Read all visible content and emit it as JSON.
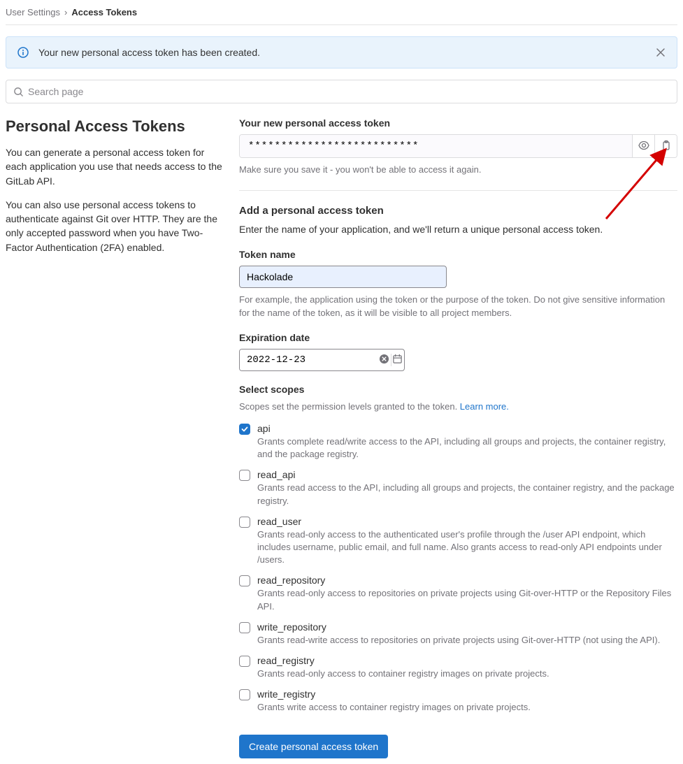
{
  "breadcrumb": {
    "parent": "User Settings",
    "current": "Access Tokens"
  },
  "alert": {
    "message": "Your new personal access token has been created."
  },
  "search": {
    "placeholder": "Search page"
  },
  "sidebar": {
    "heading": "Personal Access Tokens",
    "para1": "You can generate a personal access token for each application you use that needs access to the GitLab API.",
    "para2": "You can also use personal access tokens to authenticate against Git over HTTP. They are the only accepted password when you have Two-Factor Authentication (2FA) enabled."
  },
  "token": {
    "label": "Your new personal access token",
    "value": "**************************",
    "save_hint": "Make sure you save it - you won't be able to access it again."
  },
  "add": {
    "heading": "Add a personal access token",
    "desc": "Enter the name of your application, and we'll return a unique personal access token.",
    "name_label": "Token name",
    "name_value": "Hackolade",
    "name_hint": "For example, the application using the token or the purpose of the token. Do not give sensitive information for the name of the token, as it will be visible to all project members.",
    "exp_label": "Expiration date",
    "exp_value": "2022-12-23"
  },
  "scopes": {
    "heading": "Select scopes",
    "desc_prefix": "Scopes set the permission levels granted to the token. ",
    "learn_more": "Learn more.",
    "items": [
      {
        "name": "api",
        "checked": true,
        "desc": "Grants complete read/write access to the API, including all groups and projects, the container registry, and the package registry."
      },
      {
        "name": "read_api",
        "checked": false,
        "desc": "Grants read access to the API, including all groups and projects, the container registry, and the package registry."
      },
      {
        "name": "read_user",
        "checked": false,
        "desc": "Grants read-only access to the authenticated user's profile through the /user API endpoint, which includes username, public email, and full name. Also grants access to read-only API endpoints under /users."
      },
      {
        "name": "read_repository",
        "checked": false,
        "desc": "Grants read-only access to repositories on private projects using Git-over-HTTP or the Repository Files API."
      },
      {
        "name": "write_repository",
        "checked": false,
        "desc": "Grants read-write access to repositories on private projects using Git-over-HTTP (not using the API)."
      },
      {
        "name": "read_registry",
        "checked": false,
        "desc": "Grants read-only access to container registry images on private projects."
      },
      {
        "name": "write_registry",
        "checked": false,
        "desc": "Grants write access to container registry images on private projects."
      }
    ]
  },
  "submit": {
    "label": "Create personal access token"
  }
}
